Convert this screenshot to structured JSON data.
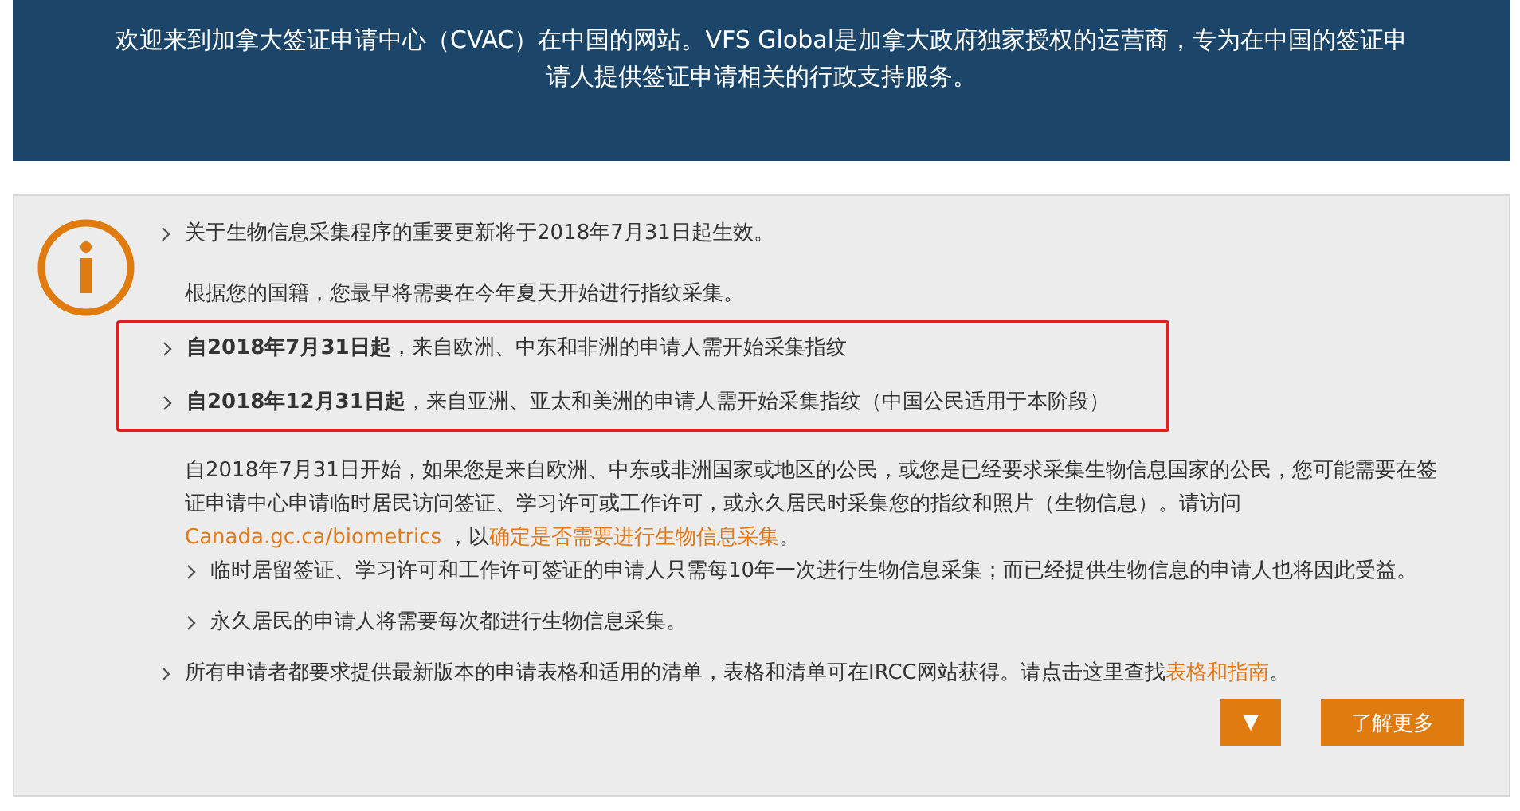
{
  "banner": {
    "text": "欢迎来到加拿大签证申请中心（CVAC）在中国的网站。VFS Global是加拿大政府独家授权的运营商，专为在中国的签证申请人提供签证申请相关的行政支持服务。"
  },
  "notice": {
    "intro": [
      {
        "kind": "bullet",
        "text": "关于生物信息采集程序的重要更新将于2018年7月31日起生效。"
      },
      {
        "kind": "plain",
        "text": "根据您的国籍，您最早将需要在今年夏天开始进行指纹采集。"
      }
    ],
    "highlighted": [
      {
        "text": "**自2018年7月31日起**，来自欧洲、中东和非洲的申请人需开始采集指纹"
      },
      {
        "text": "**自2018年12月31日起**，来自亚洲、亚太和美洲的申请人需开始采集指纹（中国公民适用于本阶段）"
      }
    ],
    "paragraph": [
      {
        "kind": "text",
        "text": "自2018年7月31日开始，如果您是来自欧洲、中东或非洲国家或地区的公民，或您是已经要求采集生物信息国家的公民，您可能需要在签证申请中心申请临时居民访问签证、学习许可或工作许可，或永久居民时采集您的指纹和照片（生物信息）。请访问"
      },
      {
        "kind": "link",
        "text": "Canada.gc.ca/biometrics"
      },
      {
        "kind": "text",
        "text": " ，以"
      },
      {
        "kind": "link",
        "text": "确定是否需要进行生物信息采集"
      },
      {
        "kind": "text",
        "text": "。"
      }
    ],
    "sub_bullets": [
      "临时居留签证、学习许可和工作许可签证的申请人只需每10年一次进行生物信息采集；而已经提供生物信息的申请人也将因此受益。",
      "永久居民的申请人将需要每次都进行生物信息采集。"
    ],
    "final": {
      "text": "所有申请者都要求提供最新版本的申请表格和适用的清单，表格和清单可在IRCC网站获得。请点击这里查找",
      "link": "表格和指南",
      "tail": "。"
    },
    "buttons": {
      "expand": "▼",
      "more": "了解更多"
    }
  }
}
